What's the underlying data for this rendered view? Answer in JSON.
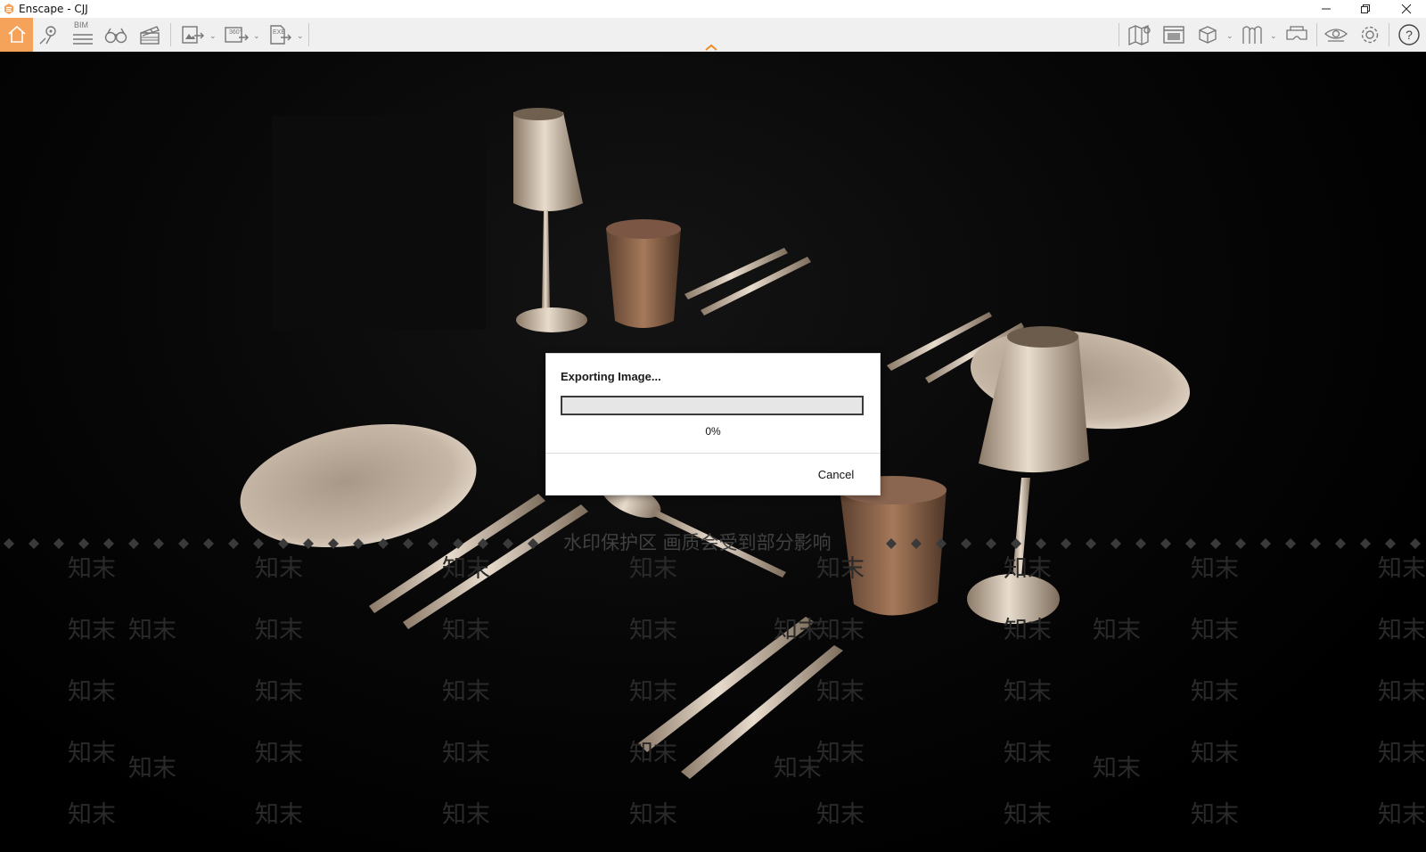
{
  "window": {
    "title": "Enscape - CJJ"
  },
  "colors": {
    "accent": "#f5a25a",
    "toolbar_bg": "#f0f0f0",
    "viewport_bg": "#000000"
  },
  "toolbar": {
    "left_tools": [
      "home-icon",
      "location-pin-icon",
      "bim-icon",
      "binoculars-icon",
      "clapper-icon"
    ],
    "bim_label": "BIM",
    "export_tools": [
      "screenshot-export-icon",
      "panorama-export-icon",
      "exe-export-icon"
    ],
    "pano_label": "360°",
    "exe_label": "EXE",
    "right_tools": [
      "map-icon",
      "view-management-icon",
      "asset-library-icon",
      "material-icon",
      "vr-headset-icon",
      "visual-settings-icon",
      "settings-gear-icon",
      "help-icon"
    ]
  },
  "watermark": {
    "notice": "水印保护区 画质会受到部分影响",
    "mark": "知末"
  },
  "dialog": {
    "title": "Exporting Image...",
    "progress": 0,
    "progress_label": "0%",
    "cancel_label": "Cancel"
  }
}
